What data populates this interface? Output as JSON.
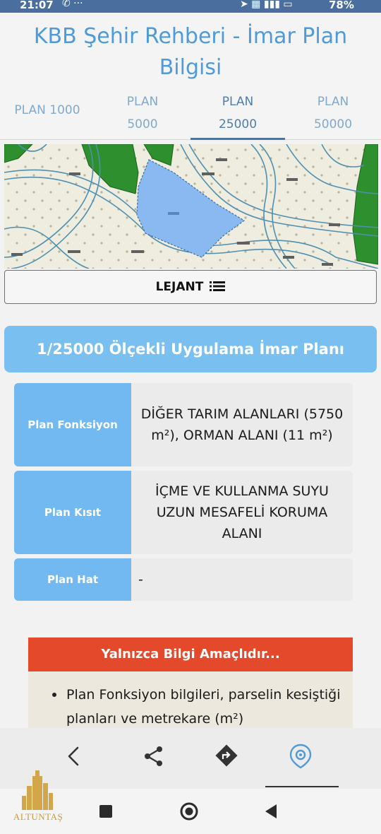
{
  "status_bar": {
    "time": "21:07",
    "battery": "78%"
  },
  "header": {
    "title": "KBB Şehir Rehberi - İmar Plan Bilgisi",
    "tabs": [
      {
        "line1": "PLAN 1000",
        "line2": ""
      },
      {
        "line1": "PLAN",
        "line2": "5000"
      },
      {
        "line1": "PLAN",
        "line2": "25000"
      },
      {
        "line1": "PLAN",
        "line2": "50000"
      }
    ],
    "active_tab": 2
  },
  "legend_button": {
    "label": "LEJANT",
    "icon": "list-icon"
  },
  "scale_title": "1/25000 Ölçekli Uygulama İmar Planı",
  "info": {
    "rows": [
      {
        "key": "Plan Fonksiyon",
        "value": "DİĞER TARIM ALANLARI (5750 m²), ORMAN ALANI (11 m²)"
      },
      {
        "key": "Plan Kısıt",
        "value": "İÇME VE KULLANMA SUYU UZUN MESAFELİ KORUMA ALANI"
      },
      {
        "key": "Plan Hat",
        "value": "-"
      }
    ]
  },
  "notice": {
    "header": "Yalnızca Bilgi Amaçlıdır...",
    "bullet": "Plan Fonksiyon bilgileri, parselin kesiştiği planları ve metrekare (m²)"
  },
  "toolbar": {
    "icons": [
      "back-icon",
      "share-icon",
      "directions-icon",
      "location-icon"
    ]
  },
  "watermark": {
    "logo_text": "ALTUNTAŞ"
  },
  "colors": {
    "accent_blue": "#79bff0",
    "key_blue": "#71b9f0",
    "title_blue": "#4f9ad8",
    "notice_red": "#e5492c",
    "parcel_blue": "#8ab8f0",
    "forest_green": "#2e8f2e"
  }
}
